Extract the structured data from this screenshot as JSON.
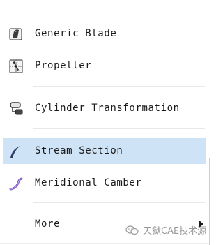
{
  "menu": {
    "items": [
      {
        "label": "Generic Blade",
        "icon": "generic-blade-icon"
      },
      {
        "label": "Propeller",
        "icon": "propeller-icon"
      },
      {
        "label": "Cylinder Transformation",
        "icon": "cylinder-transformation-icon"
      },
      {
        "label": "Stream Section",
        "icon": "stream-section-icon",
        "highlighted": true
      },
      {
        "label": "Meridional Camber",
        "icon": "meridional-camber-icon"
      },
      {
        "label": "More",
        "icon": "",
        "has_submenu": true
      }
    ]
  },
  "colors": {
    "highlight": "#cfe3f7",
    "stream_icon": "#2d3e66",
    "camber_icon": "#7e57c2",
    "watermark": "#9a9a9a"
  },
  "watermark": {
    "text": "天狱CAE技术源"
  }
}
